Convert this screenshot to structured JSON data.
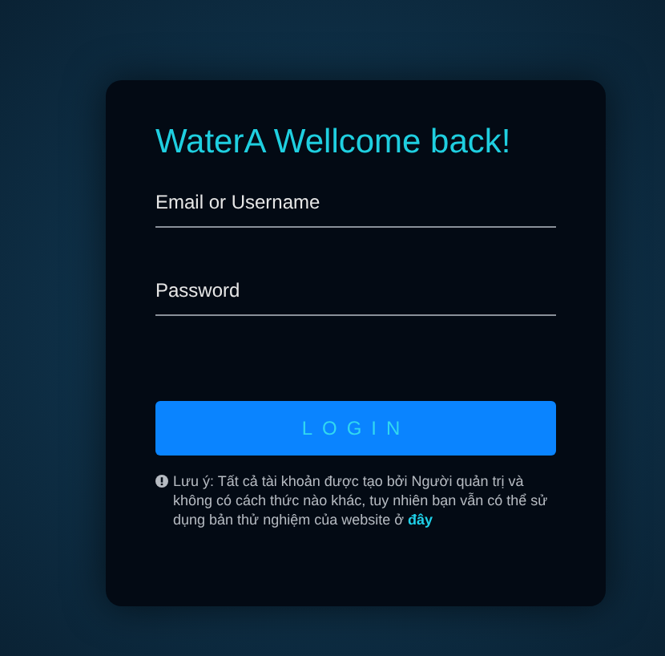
{
  "title": "WaterA Wellcome back!",
  "fields": [
    {
      "placeholder": "Email or Username"
    },
    {
      "placeholder": "Password"
    }
  ],
  "button": "LOGIN",
  "note": {
    "text": "Lưu ý: Tất cả tài khoản được tạo bởi Người quản trị và không có cách thức nào khác, tuy nhiên bạn vẫn có thể sử dụng bản thử nghiệm của website ở",
    "link": "đây"
  }
}
